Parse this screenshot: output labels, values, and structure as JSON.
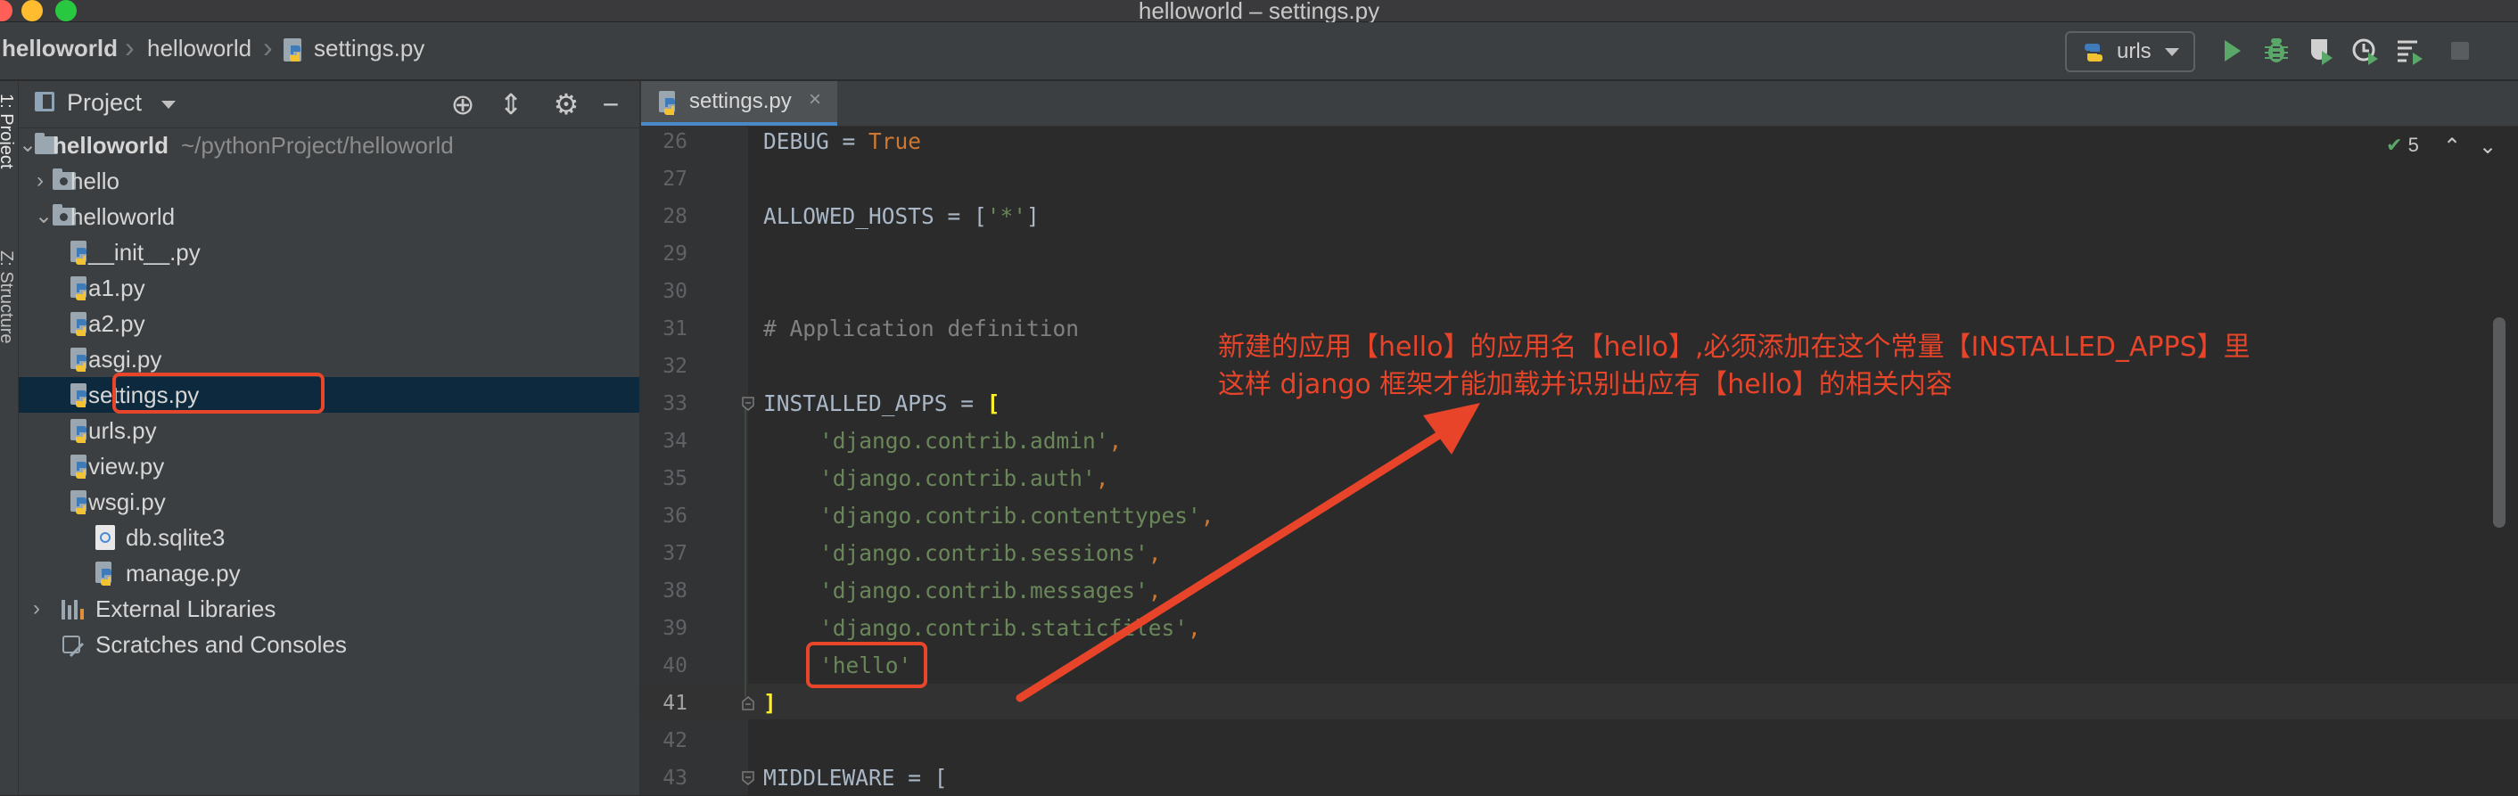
{
  "window": {
    "title": "helloworld – settings.py"
  },
  "breadcrumbs": [
    {
      "label": "helloworld"
    },
    {
      "label": "helloworld"
    },
    {
      "label": "settings.py"
    }
  ],
  "toolbar": {
    "run_config": "urls",
    "buttons": [
      "run-icon",
      "debug-icon",
      "coverage-icon",
      "profile-icon",
      "concurrency-icon",
      "stop-icon"
    ]
  },
  "side_tabs": {
    "project": "1: Project",
    "structure": "Z: Structure"
  },
  "project_panel": {
    "title": "Project",
    "tree": [
      {
        "label": "helloworld",
        "sub": "~/pythonProject/helloworld",
        "type": "folder",
        "expanded": true
      },
      {
        "label": "hello",
        "type": "package",
        "expanded": false
      },
      {
        "label": "helloworld",
        "type": "package",
        "expanded": true
      },
      {
        "label": "__init__.py",
        "type": "python"
      },
      {
        "label": "a1.py",
        "type": "python"
      },
      {
        "label": "a2.py",
        "type": "python"
      },
      {
        "label": "asgi.py",
        "type": "python"
      },
      {
        "label": "settings.py",
        "type": "python",
        "selected": true
      },
      {
        "label": "urls.py",
        "type": "python"
      },
      {
        "label": "view.py",
        "type": "python"
      },
      {
        "label": "wsgi.py",
        "type": "python"
      },
      {
        "label": "db.sqlite3",
        "type": "database"
      },
      {
        "label": "manage.py",
        "type": "python"
      },
      {
        "label": "External Libraries",
        "type": "library",
        "expanded": false
      },
      {
        "label": "Scratches and Consoles",
        "type": "scratches"
      }
    ]
  },
  "editor": {
    "tab": "settings.py",
    "inspection_count": "5",
    "current_line": "41",
    "line_numbers": [
      "26",
      "27",
      "28",
      "29",
      "30",
      "31",
      "32",
      "33",
      "34",
      "35",
      "36",
      "37",
      "38",
      "39",
      "40",
      "41",
      "42",
      "43"
    ],
    "lines": {
      "l26": {
        "a": "DEBUG = ",
        "b": "True"
      },
      "l28": {
        "a": "ALLOWED_HOSTS = [",
        "b": "'*'",
        "c": "]"
      },
      "l31": "# Application definition",
      "l33": {
        "a": "INSTALLED_APPS = ",
        "b": "["
      },
      "l34": {
        "s": "'django.contrib.admin'",
        "p": ","
      },
      "l35": {
        "s": "'django.contrib.auth'",
        "p": ","
      },
      "l36": {
        "s": "'django.contrib.contenttypes'",
        "p": ","
      },
      "l37": {
        "s": "'django.contrib.sessions'",
        "p": ","
      },
      "l38": {
        "s": "'django.contrib.messages'",
        "p": ","
      },
      "l39": {
        "s": "'django.contrib.staticfiles'",
        "p": ","
      },
      "l40": {
        "s": "'hello'"
      },
      "l41": "]",
      "l43": "MIDDLEWARE = ["
    }
  },
  "annotation": {
    "line1": "新建的应用【hello】的应用名【hello】,必须添加在这个常量【INSTALLED_APPS】里",
    "line2": "这样 django 框架才能加载并识别出应有【hello】的相关内容",
    "color": "#e8442a"
  },
  "colors": {
    "keyword": "#cc7832",
    "string": "#6a8759",
    "comment": "#808080",
    "selection": "#0d293e"
  }
}
